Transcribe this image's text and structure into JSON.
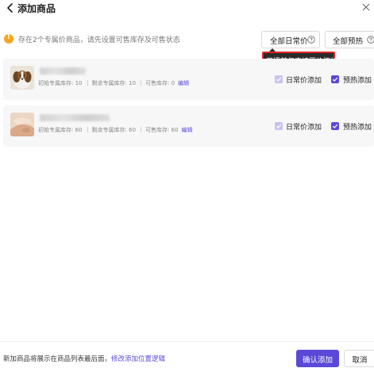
{
  "header": {
    "back_icon": "chevron-left-icon",
    "title": "添加商品",
    "close_icon": "close-icon"
  },
  "notice": {
    "icon": "warning-icon",
    "icon_glyph": "!",
    "text": "存在2个专属价商品，请先设置可售库存及可售状态"
  },
  "bulk_actions": {
    "all_normal_label": "全部日常价",
    "all_preheat_label": "全部预热"
  },
  "tooltip": {
    "text": "开播前仅支持原价添加"
  },
  "products": [
    {
      "thumbnail": "dog-photo",
      "stock": {
        "initial_label": "初始专属库存:",
        "initial_value": "10",
        "remaining_label": "剩余专属库存:",
        "remaining_value": "10",
        "sellable_label": "可售库存:",
        "sellable_value": "0",
        "edit_label": "编辑"
      },
      "options": {
        "normal_label": "日常价添加",
        "normal_checked": true,
        "normal_disabled": true,
        "preheat_label": "预热添加",
        "preheat_checked": true
      }
    },
    {
      "thumbnail": "hand-product-photo",
      "stock": {
        "initial_label": "初始专属库存:",
        "initial_value": "60",
        "remaining_label": "剩余专属库存:",
        "remaining_value": "60",
        "sellable_label": "可售库存:",
        "sellable_value": "60",
        "edit_label": "编辑"
      },
      "options": {
        "normal_label": "日常价添加",
        "normal_checked": true,
        "normal_disabled": true,
        "preheat_label": "预热添加",
        "preheat_checked": true
      }
    }
  ],
  "footer": {
    "note": "新加商品将展示在商品列表最后面，",
    "link": "修改添加位置逻辑",
    "confirm_label": "确认添加",
    "cancel_label": "取消"
  },
  "colors": {
    "accent": "#5a48d8",
    "accent_disabled": "#c9c2f0",
    "warning": "#f5a623",
    "tooltip_bg": "#2b2b2b",
    "highlight_border": "#e02424",
    "card_bg": "#f7f7f8"
  }
}
